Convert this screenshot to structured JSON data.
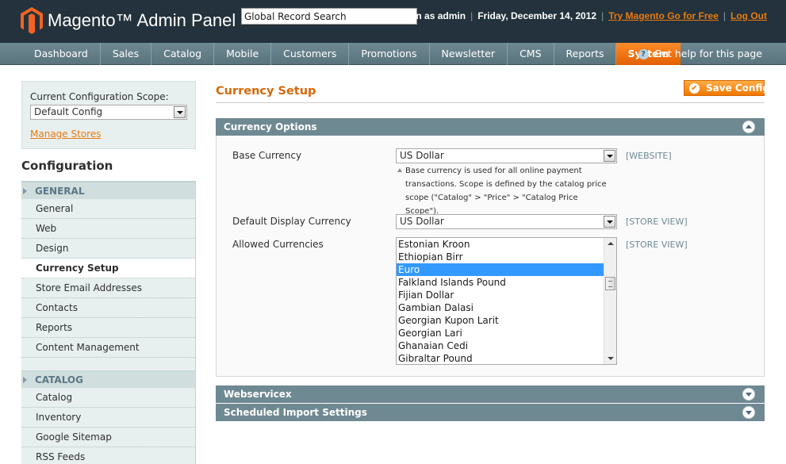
{
  "header": {
    "logo_text": "Magento™ Admin Panel",
    "search_value": "Global Record Search",
    "logged_in": "Logged in as admin",
    "date": "Friday, December 14, 2012",
    "try_link": "Try Magento Go for Free",
    "logout": "Log Out",
    "brand_color": "#ea7a0f"
  },
  "nav": {
    "items": [
      "Dashboard",
      "Sales",
      "Catalog",
      "Mobile",
      "Customers",
      "Promotions",
      "Newsletter",
      "CMS",
      "Reports",
      "System"
    ],
    "active": "System",
    "help": "Get help for this page",
    "help_icon": "question-icon"
  },
  "scope": {
    "label": "Current Configuration Scope:",
    "value": "Default Config",
    "manage_stores": "Manage Stores"
  },
  "sidebar": {
    "title": "Configuration",
    "groups": [
      {
        "label": "GENERAL",
        "items": [
          "General",
          "Web",
          "Design",
          "Currency Setup",
          "Store Email Addresses",
          "Contacts",
          "Reports",
          "Content Management"
        ]
      },
      {
        "label": "CATALOG",
        "items": [
          "Catalog",
          "Inventory",
          "Google Sitemap",
          "RSS Feeds"
        ]
      }
    ],
    "active_item": "Currency Setup"
  },
  "main": {
    "title": "Currency Setup",
    "save_button": "Save Config",
    "sections": {
      "currency_options": {
        "title": "Currency Options",
        "base_currency": {
          "label": "Base Currency",
          "value": "US Dollar",
          "scope": "[WEBSITE]",
          "note_lines": [
            "Base currency is used for all online payment",
            "transactions. Scope is defined by the catalog price",
            "scope (\"Catalog\" > \"Price\" > \"Catalog Price Scope\")."
          ]
        },
        "display_currency": {
          "label": "Default Display Currency",
          "value": "US Dollar",
          "scope": "[STORE VIEW]"
        },
        "allowed_currencies": {
          "label": "Allowed Currencies",
          "scope": "[STORE VIEW]",
          "options": [
            "Estonian Kroon",
            "Ethiopian Birr",
            "Euro",
            "Falkland Islands Pound",
            "Fijian Dollar",
            "Gambian Dalasi",
            "Georgian Kupon Larit",
            "Georgian Lari",
            "Ghanaian Cedi",
            "Gibraltar Pound"
          ],
          "selected": "Euro"
        }
      },
      "webservicex": {
        "title": "Webservicex"
      },
      "scheduled_import": {
        "title": "Scheduled Import Settings"
      }
    }
  }
}
